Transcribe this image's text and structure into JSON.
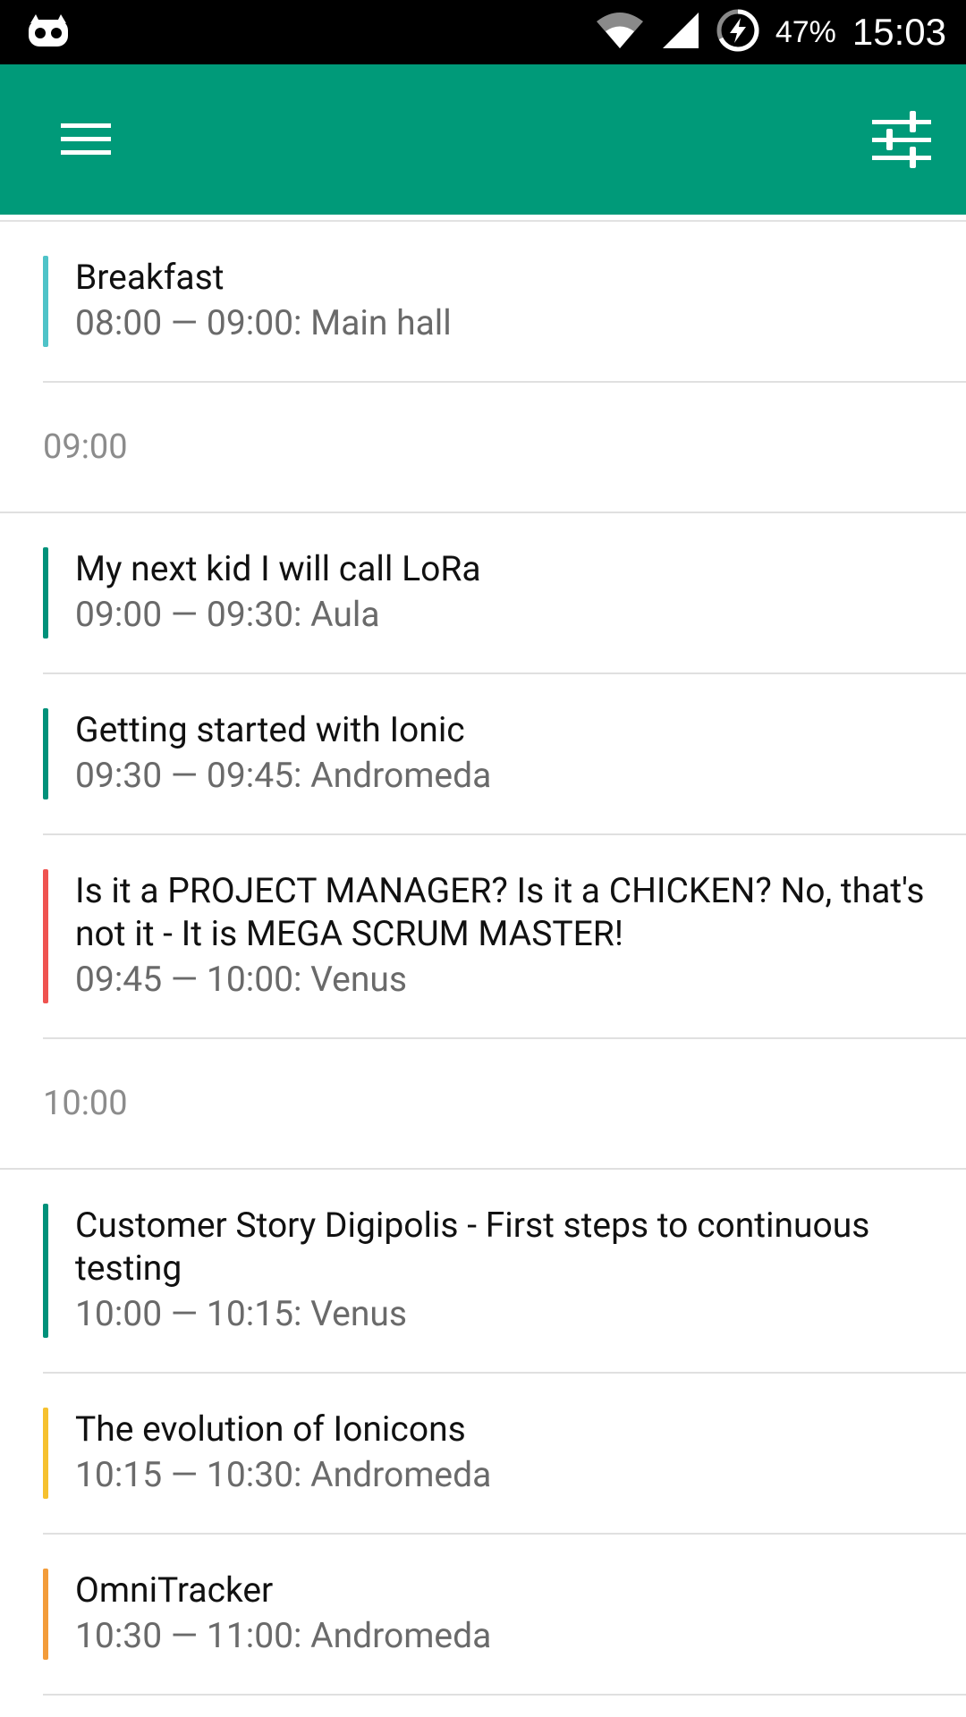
{
  "status_bar": {
    "battery": "47%",
    "time": "15:03"
  },
  "schedule": {
    "groups": [
      {
        "time": "",
        "sessions": [
          {
            "title": "Breakfast",
            "meta": "08:00 — 09:00: Main hall",
            "color": "#4fc3c8"
          }
        ]
      },
      {
        "time": "09:00",
        "sessions": [
          {
            "title": "My next kid I will call LoRa",
            "meta": "09:00 — 09:30: Aula",
            "color": "#00917a"
          },
          {
            "title": "Getting started with Ionic",
            "meta": "09:30 — 09:45: Andromeda",
            "color": "#00917a"
          },
          {
            "title": "Is it a PROJECT MANAGER? Is it a CHICKEN? No, that's not it - It is MEGA SCRUM MASTER!",
            "meta": "09:45 — 10:00: Venus",
            "color": "#ef5350"
          }
        ]
      },
      {
        "time": "10:00",
        "sessions": [
          {
            "title": "Customer Story Digipolis - First steps to continuous testing",
            "meta": "10:00 — 10:15: Venus",
            "color": "#00917a"
          },
          {
            "title": "The evolution of Ionicons",
            "meta": "10:15 — 10:30: Andromeda",
            "color": "#f6c12f"
          },
          {
            "title": "OmniTracker",
            "meta": "10:30 — 11:00: Andromeda",
            "color": "#f39c3a"
          }
        ]
      }
    ]
  }
}
